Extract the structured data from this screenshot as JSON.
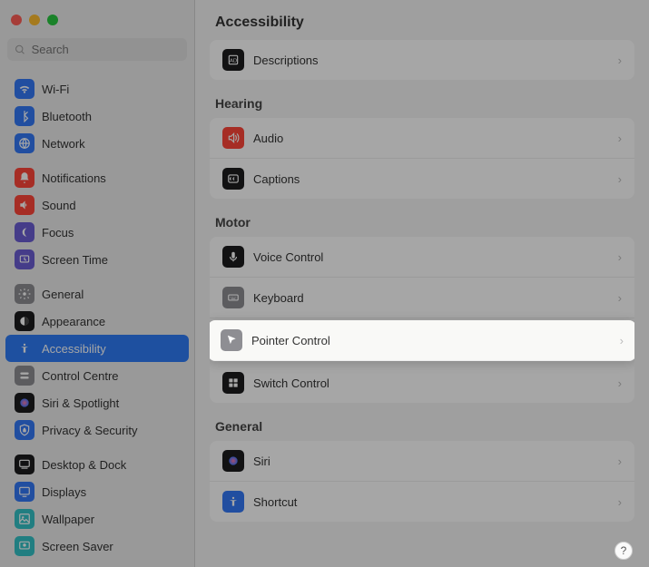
{
  "search": {
    "placeholder": "Search"
  },
  "sidebar": {
    "groups": [
      [
        {
          "key": "wifi",
          "label": "Wi-Fi",
          "bg": "#3478f6"
        },
        {
          "key": "bluetooth",
          "label": "Bluetooth",
          "bg": "#3478f6"
        },
        {
          "key": "network",
          "label": "Network",
          "bg": "#3478f6"
        }
      ],
      [
        {
          "key": "notifications",
          "label": "Notifications",
          "bg": "#ff4539"
        },
        {
          "key": "sound",
          "label": "Sound",
          "bg": "#ff4539"
        },
        {
          "key": "focus",
          "label": "Focus",
          "bg": "#6b5dd3"
        },
        {
          "key": "screentime",
          "label": "Screen Time",
          "bg": "#6b5dd3"
        }
      ],
      [
        {
          "key": "general",
          "label": "General",
          "bg": "#8e8e93"
        },
        {
          "key": "appearance",
          "label": "Appearance",
          "bg": "#1c1c1e"
        },
        {
          "key": "accessibility",
          "label": "Accessibility",
          "bg": "#2f7cf6",
          "selected": true
        },
        {
          "key": "controlcentre",
          "label": "Control Centre",
          "bg": "#8e8e93"
        },
        {
          "key": "siri",
          "label": "Siri & Spotlight",
          "bg": "#1c1c1e"
        },
        {
          "key": "privacy",
          "label": "Privacy & Security",
          "bg": "#3478f6"
        }
      ],
      [
        {
          "key": "desktop",
          "label": "Desktop & Dock",
          "bg": "#1c1c1e"
        },
        {
          "key": "displays",
          "label": "Displays",
          "bg": "#3478f6"
        },
        {
          "key": "wallpaper",
          "label": "Wallpaper",
          "bg": "#34c2c7"
        },
        {
          "key": "screensaver",
          "label": "Screen Saver",
          "bg": "#34c2c7"
        }
      ]
    ]
  },
  "main": {
    "title": "Accessibility",
    "pre_rows": [
      {
        "key": "descriptions",
        "label": "Descriptions",
        "bg": "#1c1c1e"
      }
    ],
    "sections": [
      {
        "label": "Hearing",
        "rows": [
          {
            "key": "audio",
            "label": "Audio",
            "bg": "#ff4539"
          },
          {
            "key": "captions",
            "label": "Captions",
            "bg": "#1c1c1e"
          }
        ]
      },
      {
        "label": "Motor",
        "rows": [
          {
            "key": "voicecontrol",
            "label": "Voice Control",
            "bg": "#1c1c1e"
          },
          {
            "key": "keyboard",
            "label": "Keyboard",
            "bg": "#8e8e93"
          },
          {
            "key": "pointercontrol",
            "label": "Pointer Control",
            "bg": "#8e8e93",
            "highlighted": true
          },
          {
            "key": "switchcontrol",
            "label": "Switch Control",
            "bg": "#1c1c1e"
          }
        ]
      },
      {
        "label": "General",
        "rows": [
          {
            "key": "siri",
            "label": "Siri",
            "bg": "#1c1c1e"
          },
          {
            "key": "shortcut",
            "label": "Shortcut",
            "bg": "#3478f6"
          }
        ]
      }
    ]
  },
  "help": "?"
}
